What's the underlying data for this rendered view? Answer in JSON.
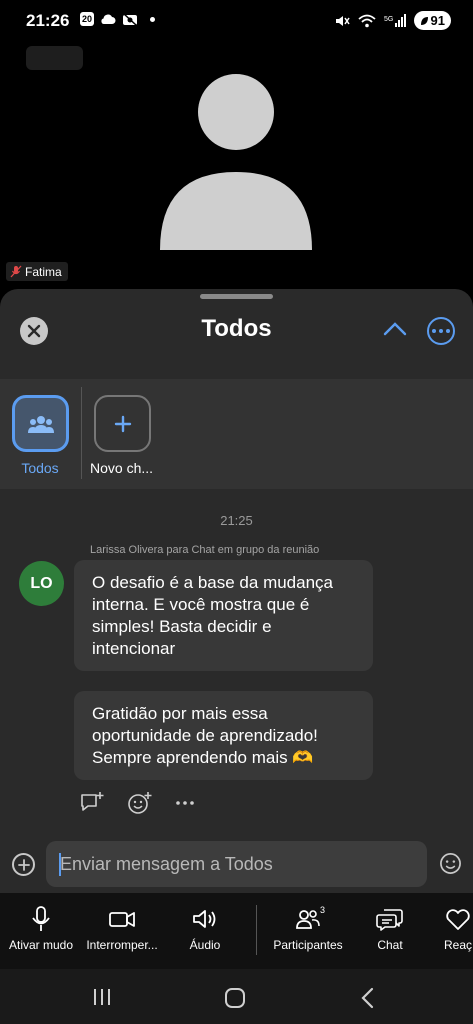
{
  "status_bar": {
    "time": "21:26",
    "badge_20": "20",
    "battery": "91"
  },
  "video": {
    "speaker_name": "Fatima"
  },
  "panel": {
    "title": "Todos",
    "chips": [
      {
        "label": "Todos"
      },
      {
        "label": "Novo ch..."
      }
    ]
  },
  "chat": {
    "timestamp": "21:25",
    "sender_line": "Larissa Olivera para Chat em grupo da reunião",
    "sender_initials": "LO",
    "messages": [
      {
        "text": "O desafio é a base da mudança interna.  E você mostra que é simples! Basta decidir e intencionar"
      },
      {
        "text": "Gratidão por mais essa oportunidade de aprendizado! Sempre aprendendo mais 🫶"
      }
    ],
    "input_placeholder": "Enviar mensagem a Todos"
  },
  "toolbar": {
    "items": [
      {
        "label": "Ativar mudo",
        "icon": "microphone-icon"
      },
      {
        "label": "Interromper...",
        "icon": "video-camera-icon"
      },
      {
        "label": "Áudio",
        "icon": "speaker-icon"
      },
      {
        "label": "Participantes",
        "icon": "participants-icon",
        "count": "3"
      },
      {
        "label": "Chat",
        "icon": "chat-icon"
      },
      {
        "label": "Reaç",
        "icon": "reactions-icon"
      }
    ]
  },
  "colors": {
    "accent": "#5b9cf0",
    "avatar_green": "#2e7d3a",
    "panel_bg": "#2a2a2a",
    "bubble_bg": "#383838"
  }
}
